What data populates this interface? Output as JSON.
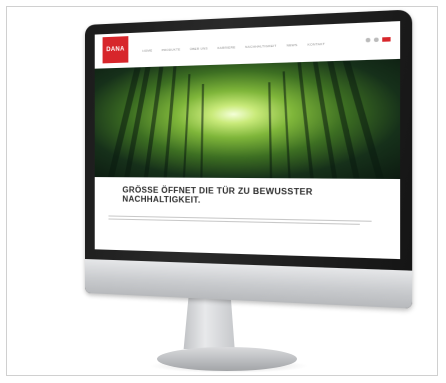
{
  "site": {
    "logo_text": "DANA",
    "nav_items": [
      "HOME",
      "PRODUKTE",
      "ÜBER UNS",
      "KARRIERE",
      "NACHHALTIGKEIT",
      "NEWS",
      "KONTAKT"
    ],
    "headline": "GRÖSSE ÖFFNET DIE TÜR ZU BEWUSSTER NACHHALTIGKEIT."
  },
  "colors": {
    "brand_red": "#d7262b"
  },
  "icons": [
    "search-icon",
    "user-icon",
    "flag-icon"
  ]
}
